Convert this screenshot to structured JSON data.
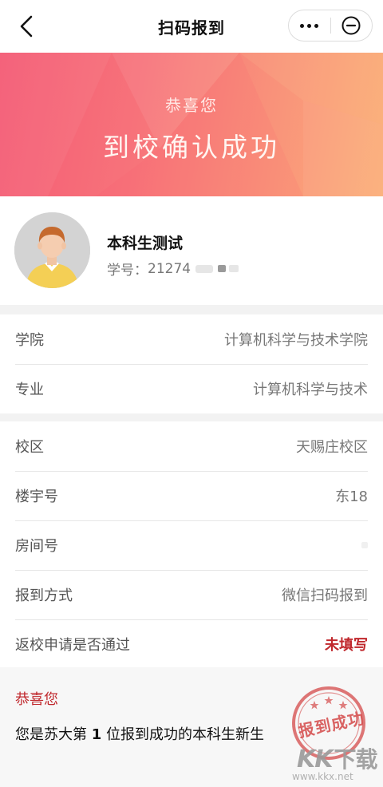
{
  "nav": {
    "title": "扫码报到",
    "back_icon": "back-arrow-icon",
    "more_icon": "more-dots-icon",
    "close_icon": "close-circle-icon"
  },
  "banner": {
    "subtitle": "恭喜您",
    "title": "到校确认成功",
    "colors": {
      "start": "#f45a74",
      "end": "#fbae78"
    }
  },
  "profile": {
    "name": "本科生测试",
    "student_id_label": "学号：",
    "student_id_value": "21274"
  },
  "info_group_1": [
    {
      "label": "学院",
      "value": "计算机科学与技术学院"
    },
    {
      "label": "专业",
      "value": "计算机科学与技术"
    }
  ],
  "info_group_2": [
    {
      "label": "校区",
      "value": "天赐庄校区"
    },
    {
      "label": "楼宇号",
      "value": "东18"
    },
    {
      "label": "房间号",
      "value": ""
    },
    {
      "label": "报到方式",
      "value": "微信扫码报到"
    },
    {
      "label": "返校申请是否通过",
      "value": "未填写"
    }
  ],
  "notice": {
    "title": "恭喜您",
    "text_before": "您是苏大第 ",
    "rank": "1",
    "text_after": " 位报到成功的本科生新生"
  },
  "stamp": {
    "text": "报到成功",
    "color": "#d44a4a"
  },
  "watermark": {
    "logo": "KK",
    "logo_cn": "下载",
    "url": "www.kkx.net"
  },
  "accent_red": "#c0282d"
}
